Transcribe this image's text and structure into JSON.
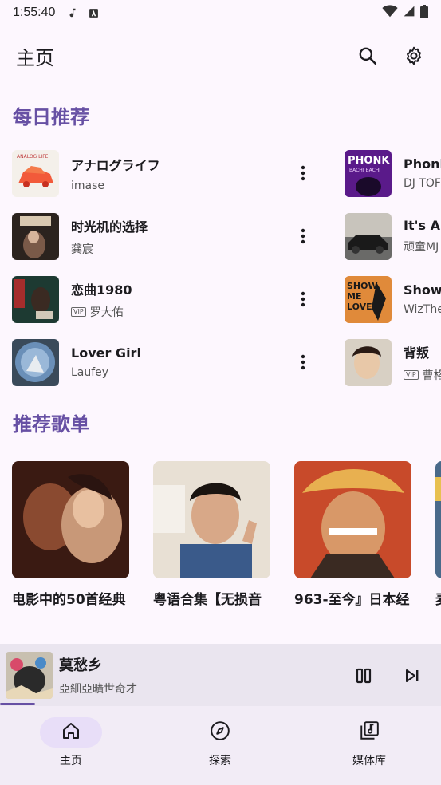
{
  "status_bar": {
    "time": "1:55:40"
  },
  "app_bar": {
    "title": "主页"
  },
  "daily": {
    "title": "每日推荐",
    "songs": [
      {
        "title": "アナログライフ",
        "artist": "imase",
        "vip": ""
      },
      {
        "title": "时光机的选择",
        "artist": "龚宸",
        "vip": ""
      },
      {
        "title": "恋曲1980",
        "artist": "罗大佑",
        "vip": "VIP"
      },
      {
        "title": "Lover Girl",
        "artist": "Laufey",
        "vip": ""
      },
      {
        "title": "Phonk",
        "artist": "DJ TOF",
        "vip": ""
      },
      {
        "title": "It's Ab",
        "artist": "顽童MJ",
        "vip": ""
      },
      {
        "title": "Show",
        "artist": "WizThe",
        "vip": ""
      },
      {
        "title": "背叛",
        "artist": "曹格",
        "vip": "VIP"
      }
    ],
    "cover_texts": {
      "phonk_1": "PHONK",
      "phonk_2": "BACHI BACHI",
      "show_1": "SHOW",
      "show_2": "ME",
      "show_3": "LOVE",
      "analog": "ANALOG LIFE"
    }
  },
  "playlists": {
    "title": "推荐歌单",
    "items": [
      {
        "title": "电影中的50首经典"
      },
      {
        "title": "粤语合集【无损音"
      },
      {
        "title": "963-至今』日本经"
      },
      {
        "title": "麦"
      }
    ]
  },
  "mini_player": {
    "title": "莫愁乡",
    "artist": "亞細亞曠世奇才",
    "progress": 0.08
  },
  "bottom_nav": {
    "items": [
      {
        "label": "主页",
        "active": true
      },
      {
        "label": "探索",
        "active": false
      },
      {
        "label": "媒体库",
        "active": false
      }
    ]
  },
  "colors": {
    "accent": "#6750a4",
    "background": "#fdf7fe",
    "nav_active": "#e8def8"
  }
}
